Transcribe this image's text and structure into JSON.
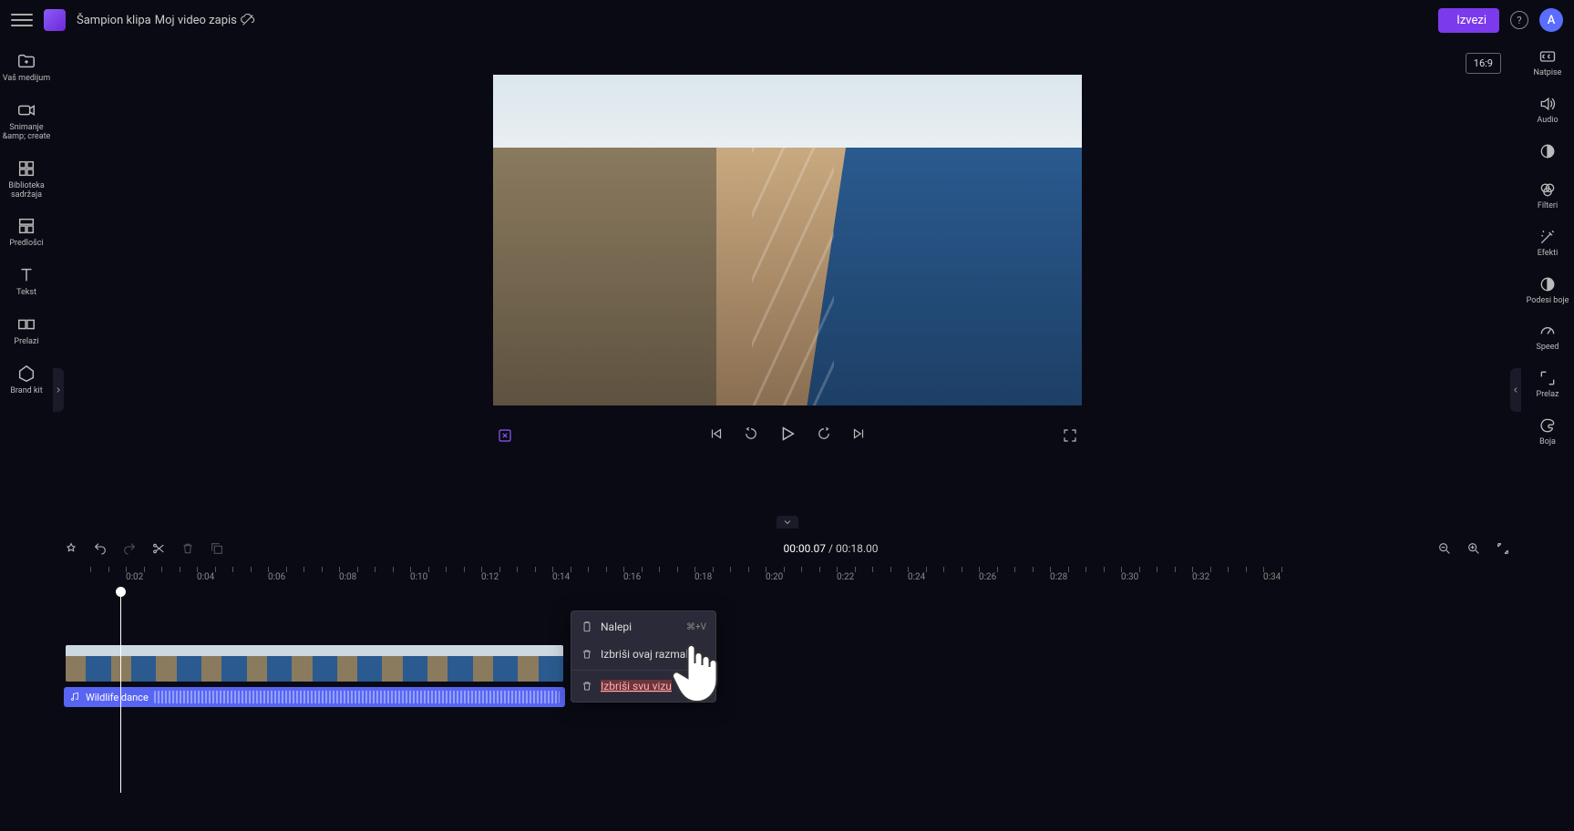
{
  "header": {
    "breadcrumb1": "Šampion klipa",
    "breadcrumb2": "Moj video zapis",
    "export_label": "Izvezi",
    "avatar_letter": "A"
  },
  "left_rail": [
    {
      "id": "your-media",
      "label": "Vaš medijum"
    },
    {
      "id": "record-create",
      "label": "Snimanje &amp; create"
    },
    {
      "id": "content-library",
      "label": "Biblioteka sadržaja"
    },
    {
      "id": "templates",
      "label": "Predlošci"
    },
    {
      "id": "text",
      "label": "Tekst"
    },
    {
      "id": "transitions",
      "label": "Prelazi"
    },
    {
      "id": "brand-kit",
      "label": "Brand kit"
    }
  ],
  "right_rail": [
    {
      "id": "captions",
      "label": "Natpise"
    },
    {
      "id": "audio",
      "label": "Audio"
    },
    {
      "id": "fade",
      "label": ""
    },
    {
      "id": "filters",
      "label": "Filteri"
    },
    {
      "id": "effects",
      "label": "Efekti"
    },
    {
      "id": "adjust-colors",
      "label": "Podesi boje"
    },
    {
      "id": "speed",
      "label": "Speed"
    },
    {
      "id": "transition",
      "label": "Prelaz"
    },
    {
      "id": "color",
      "label": "Boja"
    }
  ],
  "preview": {
    "aspect_label": "16:9"
  },
  "timeline": {
    "current_time": "00:00.07",
    "total_time": "00:18.00",
    "ruler_marks": [
      "0:02",
      "0:04",
      "0:06",
      "0:08",
      "0:10",
      "0:12",
      "0:14",
      "0:16",
      "0:18",
      "0:20",
      "0:22",
      "0:24",
      "0:26",
      "0:28",
      "0:30",
      "0:32",
      "0:34"
    ],
    "audio_clip_name": "Wildlife dance"
  },
  "context_menu": {
    "items": [
      {
        "id": "paste",
        "label": "Nalepi",
        "shortcut": "⌘+V",
        "icon": "paste"
      },
      {
        "id": "delete-gap",
        "label": "Izbriši ovaj razmak",
        "icon": "trash"
      },
      {
        "id": "delete-all-visible",
        "label": "Izbriši svu vizu",
        "icon": "trash",
        "highlighted": true
      }
    ]
  }
}
